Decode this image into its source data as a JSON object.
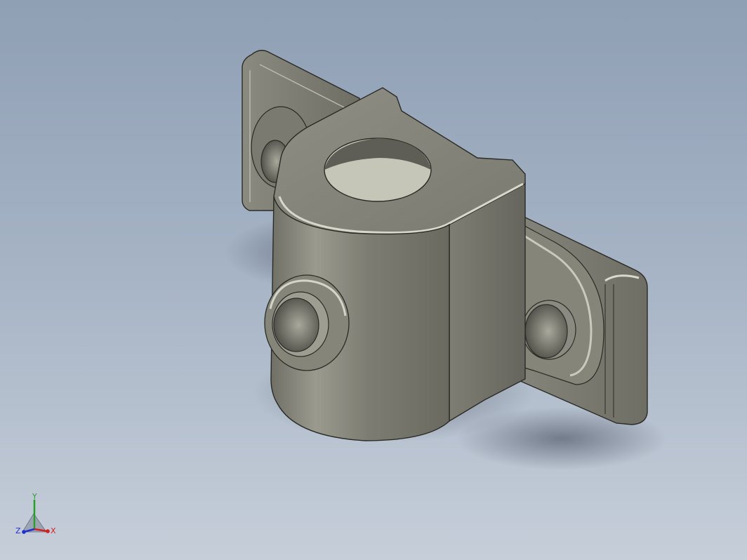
{
  "viewport": {
    "background_top": "#8f9fb4",
    "background_bottom": "#c6ced9"
  },
  "model": {
    "description_icon": "bracket-clamp-3d-model",
    "body_color": "#85857a",
    "highlight_color": "#cfcfc4",
    "edge_color": "#2b2b26"
  },
  "triad": {
    "x_label": "X",
    "y_label": "Y",
    "z_label": "Z",
    "x_color": "#d62020",
    "y_color": "#2aa02a",
    "z_color": "#2030d0"
  }
}
